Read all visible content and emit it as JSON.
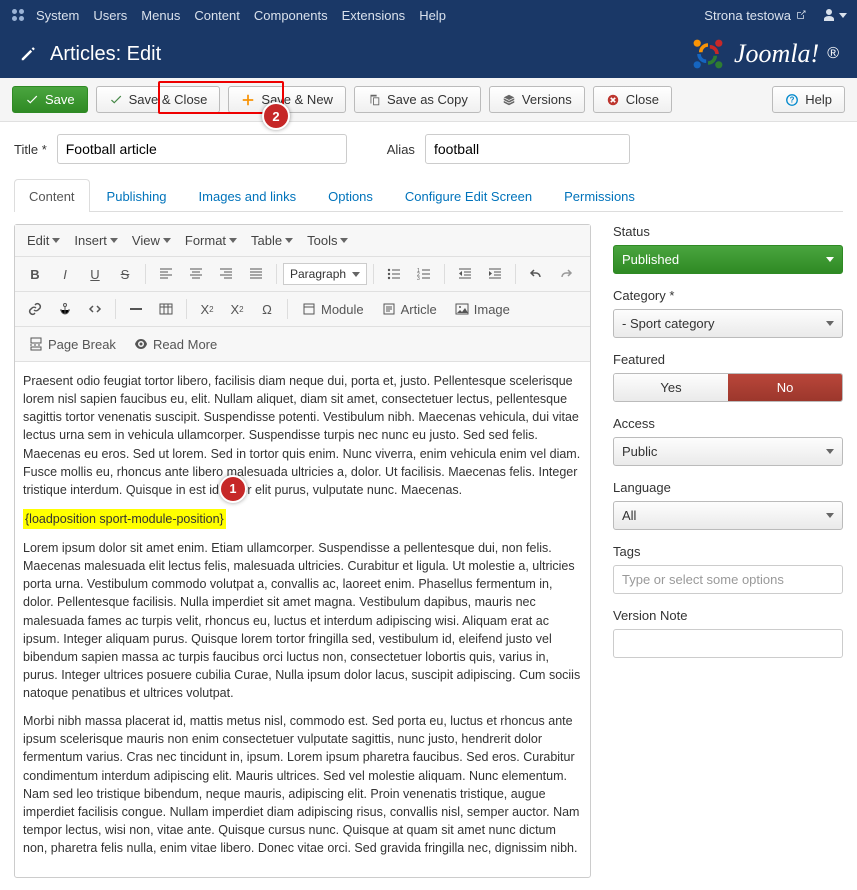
{
  "topbar": {
    "menus": [
      "System",
      "Users",
      "Menus",
      "Content",
      "Components",
      "Extensions",
      "Help"
    ],
    "site_name": "Strona testowa"
  },
  "header": {
    "title": "Articles: Edit",
    "brand": "Joomla!"
  },
  "toolbar": {
    "save": "Save",
    "save_close": "Save & Close",
    "save_new": "Save & New",
    "save_copy": "Save as Copy",
    "versions": "Versions",
    "close": "Close",
    "help": "Help"
  },
  "callouts": {
    "one": "1",
    "two": "2"
  },
  "form": {
    "title_label": "Title *",
    "title_value": "Football article",
    "alias_label": "Alias",
    "alias_value": "football"
  },
  "tabs": [
    "Content",
    "Publishing",
    "Images and links",
    "Options",
    "Configure Edit Screen",
    "Permissions"
  ],
  "editor": {
    "menus": [
      "Edit",
      "Insert",
      "View",
      "Format",
      "Table",
      "Tools"
    ],
    "paragraph": "Paragraph",
    "btn_module": "Module",
    "btn_article": "Article",
    "btn_image": "Image",
    "btn_pagebreak": "Page Break",
    "btn_readmore": "Read More",
    "paragraphs": [
      "Praesent odio feugiat tortor libero, facilisis diam neque dui, porta et, justo. Pellentesque scelerisque lorem nisl sapien faucibus eu, elit. Nullam aliquet, diam sit amet, consectetuer lectus, pellentesque sagittis tortor venenatis suscipit. Suspendisse potenti. Vestibulum nibh. Maecenas vehicula, dui vitae lectus urna sem in vehicula ullamcorper. Suspendisse turpis nec nunc eu justo. Sed sed felis. Maecenas eu eros. Sed ut lorem. Sed in tortor quis enim. Nunc viverra, enim vehicula enim vel diam. Fusce mollis eu, rhoncus ante libero malesuada ultricies a, dolor. Ut facilisis. Maecenas felis. Integer tristique interdum. Quisque in est id tortor elit purus, vulputate nunc. Maecenas.",
      "{loadposition sport-module-position}",
      "Lorem ipsum dolor sit amet enim. Etiam ullamcorper. Suspendisse a pellentesque dui, non felis. Maecenas malesuada elit lectus felis, malesuada ultricies. Curabitur et ligula. Ut molestie a, ultricies porta urna. Vestibulum commodo volutpat a, convallis ac, laoreet enim. Phasellus fermentum in, dolor. Pellentesque facilisis. Nulla imperdiet sit amet magna. Vestibulum dapibus, mauris nec malesuada fames ac turpis velit, rhoncus eu, luctus et interdum adipiscing wisi. Aliquam erat ac ipsum. Integer aliquam purus. Quisque lorem tortor fringilla sed, vestibulum id, eleifend justo vel bibendum sapien massa ac turpis faucibus orci luctus non, consectetuer lobortis quis, varius in, purus. Integer ultrices posuere cubilia Curae, Nulla ipsum dolor lacus, suscipit adipiscing. Cum sociis natoque penatibus et ultrices volutpat.",
      "Morbi nibh massa placerat id, mattis metus nisl, commodo est. Sed porta eu, luctus et rhoncus ante ipsum scelerisque mauris non enim consectetuer vulputate sagittis, nunc justo, hendrerit dolor fermentum varius. Cras nec tincidunt in, ipsum. Lorem ipsum pharetra faucibus. Sed eros. Curabitur condimentum interdum adipiscing elit. Mauris ultrices. Sed vel molestie aliquam. Nunc elementum. Nam sed leo tristique bibendum, neque mauris, adipiscing elit. Proin venenatis tristique, augue imperdiet facilisis congue. Nullam imperdiet diam adipiscing risus, convallis nisl, semper auctor. Nam tempor lectus, wisi non, vitae ante. Quisque cursus nunc. Quisque at quam sit amet nunc dictum non, pharetra felis nulla, enim vitae libero. Donec vitae orci. Sed gravida fringilla nec, dignissim nibh."
    ]
  },
  "sidebar": {
    "status": {
      "label": "Status",
      "value": "Published"
    },
    "category": {
      "label": "Category *",
      "value": "- Sport category"
    },
    "featured": {
      "label": "Featured",
      "yes": "Yes",
      "no": "No"
    },
    "access": {
      "label": "Access",
      "value": "Public"
    },
    "language": {
      "label": "Language",
      "value": "All"
    },
    "tags": {
      "label": "Tags",
      "placeholder": "Type or select some options"
    },
    "version_note": {
      "label": "Version Note"
    }
  }
}
